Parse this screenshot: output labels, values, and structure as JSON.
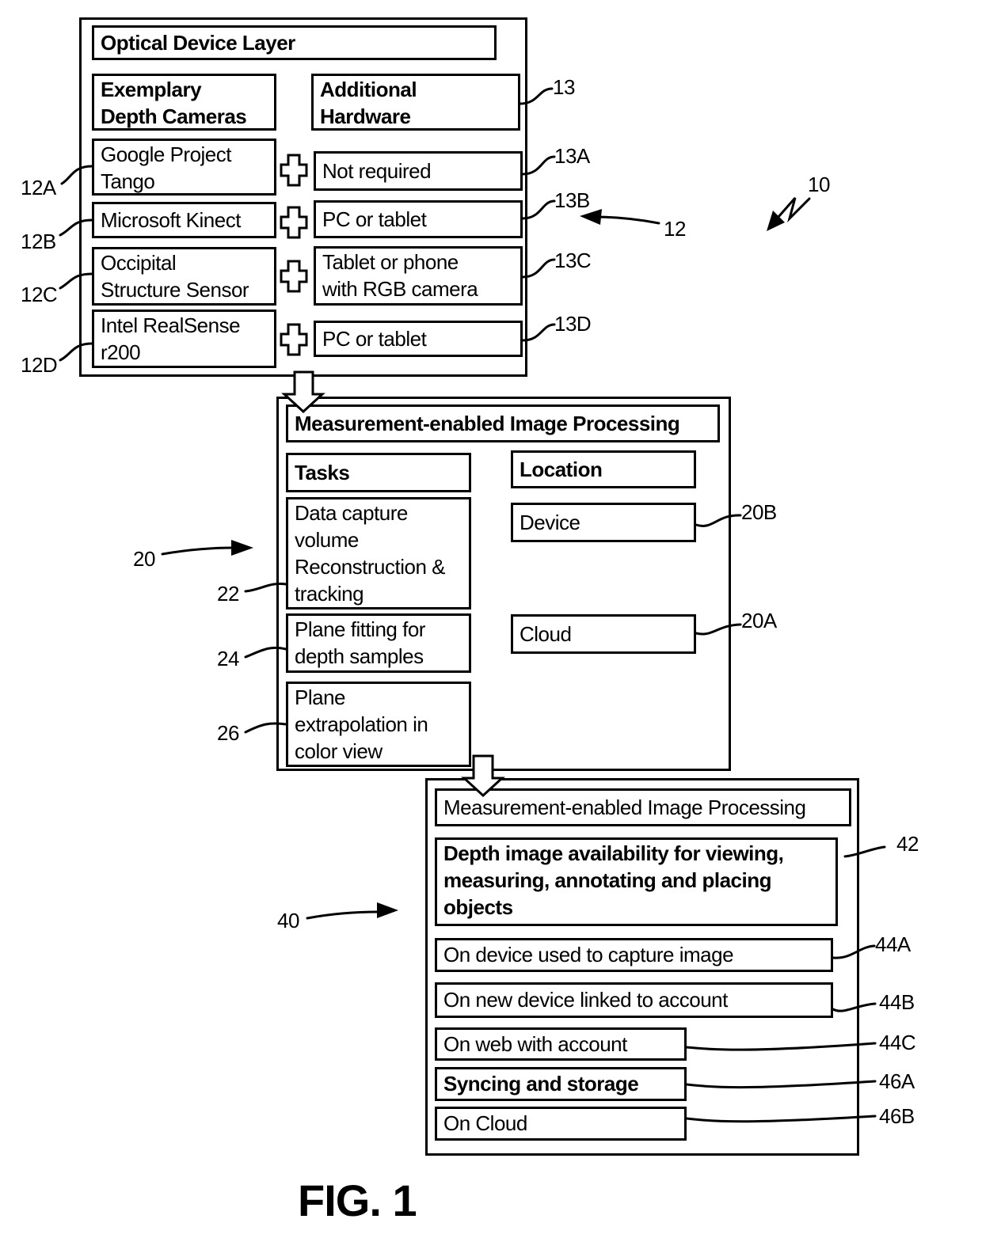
{
  "figure_label": "FIG. 1",
  "system_ref": "10",
  "optical_layer": {
    "ref": "12",
    "title": "Optical Device Layer",
    "cameras_header": [
      "Exemplary",
      "Depth Cameras"
    ],
    "hardware_header": [
      "Additional",
      "Hardware"
    ],
    "hardware_ref": "13",
    "rows": [
      {
        "camera": [
          "Google Project",
          "Tango"
        ],
        "camera_ref": "12A",
        "hardware": [
          "Not required"
        ],
        "hardware_ref": "13A"
      },
      {
        "camera": [
          "Microsoft Kinect"
        ],
        "camera_ref": "12B",
        "hardware": [
          "PC or tablet"
        ],
        "hardware_ref": "13B"
      },
      {
        "camera": [
          "Occipital",
          "Structure Sensor"
        ],
        "camera_ref": "12C",
        "hardware": [
          "Tablet or phone",
          "with RGB camera"
        ],
        "hardware_ref": "13C"
      },
      {
        "camera": [
          "Intel RealSense",
          "r200"
        ],
        "camera_ref": "12D",
        "hardware": [
          "PC or tablet"
        ],
        "hardware_ref": "13D"
      }
    ],
    "connector_icon": "plus-icon"
  },
  "processing_layer": {
    "ref": "20",
    "title": "Measurement-enabled Image Processing",
    "tasks_header": "Tasks",
    "location_header": "Location",
    "tasks": [
      {
        "lines": [
          "Data capture",
          "volume",
          "Reconstruction &",
          "tracking"
        ],
        "ref": "22"
      },
      {
        "lines": [
          "Plane fitting for",
          "depth samples"
        ],
        "ref": "24"
      },
      {
        "lines": [
          "Plane",
          "extrapolation in",
          "color view"
        ],
        "ref": "26"
      }
    ],
    "locations": [
      {
        "label": "Device",
        "ref": "20B"
      },
      {
        "label": "Cloud",
        "ref": "20A"
      }
    ]
  },
  "availability_layer": {
    "ref": "40",
    "title": "Measurement-enabled Image Processing",
    "headline": {
      "lines": [
        "Depth image availability for viewing,",
        "measuring, annotating and placing",
        "objects"
      ],
      "ref": "42"
    },
    "items": [
      {
        "label": "On device used to capture image",
        "ref": "44A"
      },
      {
        "label": "On new device linked to account",
        "ref": "44B"
      },
      {
        "label": "On web with account",
        "ref": "44C"
      },
      {
        "label": "Syncing and storage",
        "ref": "46A"
      },
      {
        "label": "On Cloud",
        "ref": "46B"
      }
    ]
  }
}
